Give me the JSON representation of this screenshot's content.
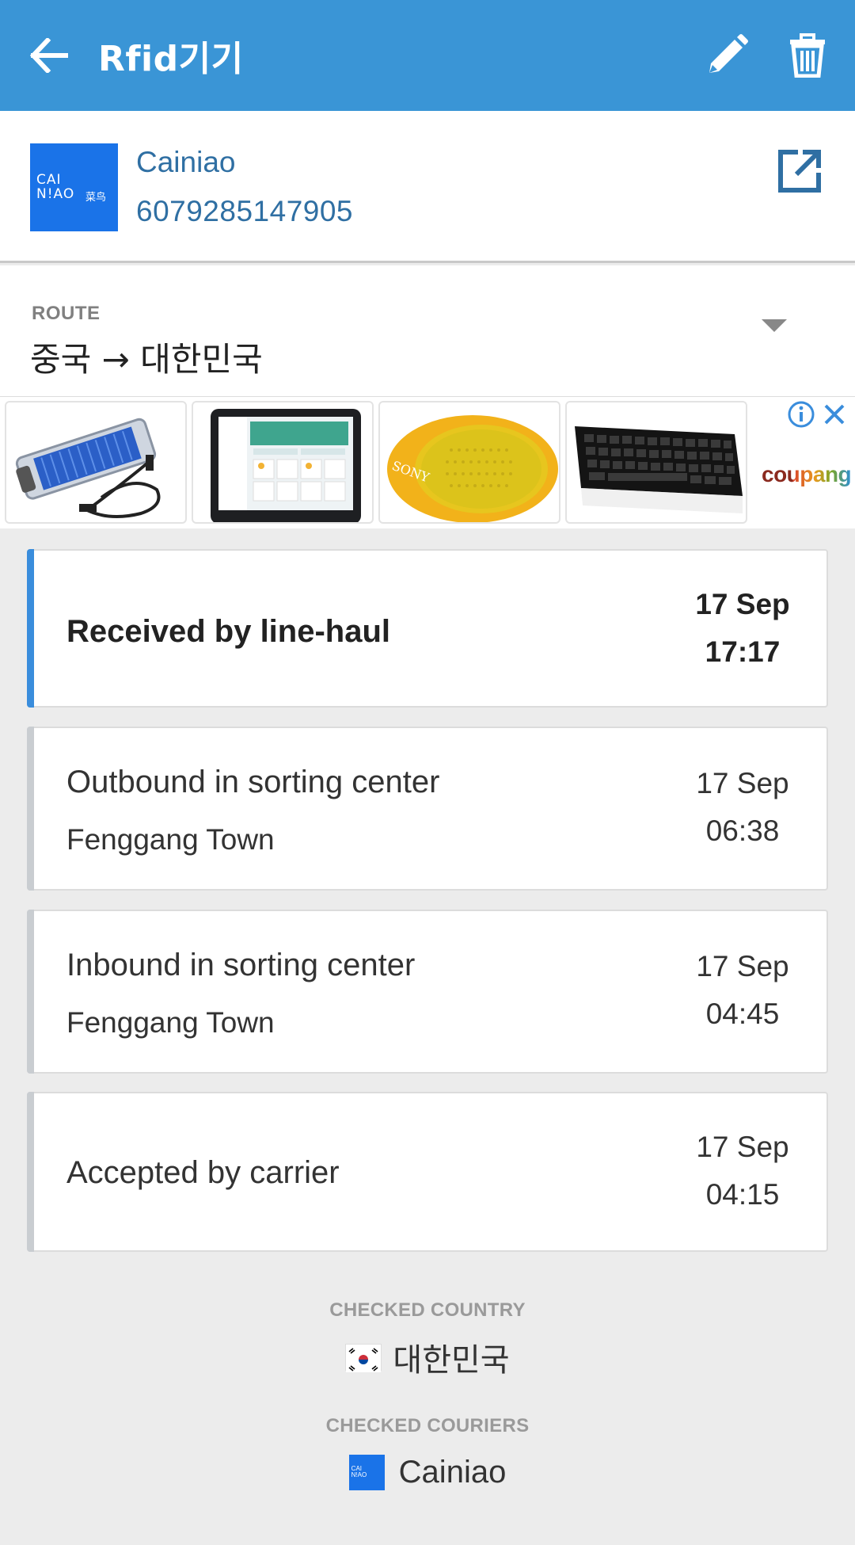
{
  "appbar": {
    "title": "Rfid기기"
  },
  "courier": {
    "logo_line1": "CAI",
    "logo_line2": "N!AO",
    "logo_cn": "菜鸟",
    "name": "Cainiao",
    "tracking_number": "6079285147905"
  },
  "route": {
    "label": "ROUTE",
    "value": "중국 → 대한민국"
  },
  "ad": {
    "brand": "coupang",
    "products": [
      "ssd-enclosure",
      "tablet",
      "sony-speaker",
      "keyboard"
    ],
    "speaker_brand": "SONY"
  },
  "events": [
    {
      "event": "Received by line-haul",
      "location": "",
      "date": "17 Sep",
      "time": "17:17",
      "active": true
    },
    {
      "event": "Outbound in sorting center",
      "location": "Fenggang Town",
      "date": "17 Sep",
      "time": "06:38",
      "active": false
    },
    {
      "event": "Inbound in sorting center",
      "location": "Fenggang Town",
      "date": "17 Sep",
      "time": "04:45",
      "active": false
    },
    {
      "event": "Accepted by carrier",
      "location": "",
      "date": "17 Sep",
      "time": "04:15",
      "active": false
    }
  ],
  "footer": {
    "country_label": "CHECKED COUNTRY",
    "country": "대한민국",
    "couriers_label": "CHECKED COURIERS",
    "courier": "Cainiao"
  },
  "colors": {
    "appbar": "#3a95d6",
    "link": "#2f6fa3",
    "active_bar": "#3a8ddc",
    "background": "#ececec"
  }
}
